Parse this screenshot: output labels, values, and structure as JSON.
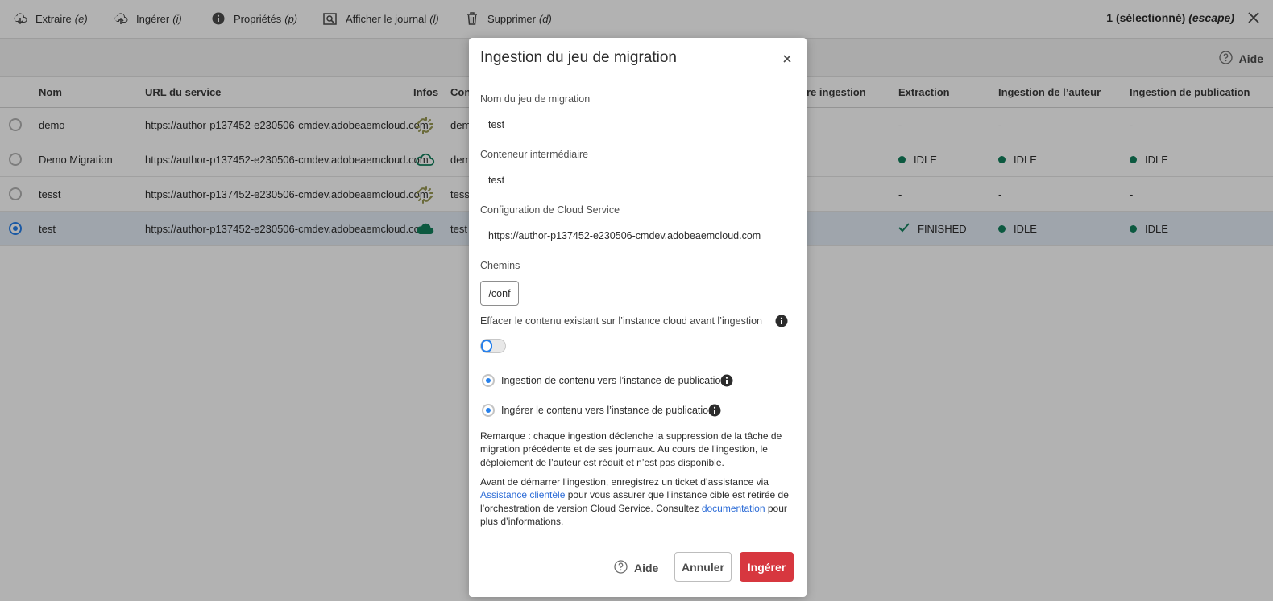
{
  "toolbar": {
    "actions": [
      {
        "label": "Extraire",
        "key": "(e)",
        "icon": "cloud-download-icon"
      },
      {
        "label": "Ingérer",
        "key": "(i)",
        "icon": "cloud-upload-icon"
      },
      {
        "label": "Propriétés",
        "key": "(p)",
        "icon": "info-icon"
      },
      {
        "label": "Afficher le journal",
        "key": "(l)",
        "icon": "view-log-icon"
      },
      {
        "label": "Supprimer",
        "key": "(d)",
        "icon": "trash-icon"
      }
    ],
    "selection": "1 (sélectionné)",
    "selection_key": "(escape)"
  },
  "subheader": {
    "help_label": "Aide"
  },
  "table": {
    "headers": {
      "name": "Nom",
      "url": "URL du service",
      "info": "Infos",
      "container": "Cont",
      "last_ingest": "re ingestion",
      "extraction": "Extraction",
      "author": "Ingestion de l’auteur",
      "publish": "Ingestion de publication"
    },
    "rows": [
      {
        "name": "demo",
        "url": "https://author-p137452-e230506-cmdev.adobeaemcloud.com",
        "container": "dem",
        "extraction": "-",
        "author": "-",
        "publish": "-",
        "info_icon": "broken-link-icon",
        "selected": false
      },
      {
        "name": "Demo Migration",
        "url": "https://author-p137452-e230506-cmdev.adobeaemcloud.com",
        "container": "dem",
        "extraction": "IDLE",
        "author": "IDLE",
        "publish": "IDLE",
        "info_icon": "cloud-outline-icon",
        "selected": false
      },
      {
        "name": "tesst",
        "url": "https://author-p137452-e230506-cmdev.adobeaemcloud.com",
        "container": "tesst",
        "extraction": "-",
        "author": "-",
        "publish": "-",
        "info_icon": "broken-link-icon",
        "selected": false
      },
      {
        "name": "test",
        "url": "https://author-p137452-e230506-cmdev.adobeaemcloud.com",
        "container": "test",
        "extraction": "FINISHED",
        "author": "IDLE",
        "publish": "IDLE",
        "info_icon": "cloud-filled-icon",
        "selected": true
      }
    ]
  },
  "colors": {
    "accent": "#2680eb",
    "status_green": "#12805c",
    "danger": "#d7373f",
    "link": "#2b6bd6"
  },
  "modal": {
    "title": "Ingestion du jeu de migration",
    "name_label": "Nom du jeu de migration",
    "name_value": "test",
    "container_label": "Conteneur intermédiaire",
    "container_value": "test",
    "cloud_config_label": "Configuration de Cloud Service",
    "cloud_config_value": "https://author-p137452-e230506-cmdev.adobeaemcloud.com",
    "paths_label": "Chemins",
    "path_chip": "/conf",
    "wipe_label": "Effacer le contenu existant sur l’instance cloud avant l’ingestion",
    "wipe_enabled": false,
    "radio1_label": "Ingestion de contenu vers l’instance de publication",
    "radio2_label": "Ingérer le contenu vers l’instance de publication",
    "note": "Remarque : chaque ingestion déclenche la suppression de la tâche de migration précédente et de ses journaux. Au cours de l’ingestion, le déploiement de l’auteur est réduit et n’est pas disponible.",
    "support_before": "Avant de démarrer l’ingestion, enregistrez un ticket d’assistance via ",
    "support_link": "Assistance clientèle",
    "support_middle": " pour vous assurer que l’instance cible est retirée de l’orchestration de version Cloud Service. Consultez ",
    "doc_link": "documentation",
    "support_after": " pour plus d’informations.",
    "help_label": "Aide",
    "cancel_label": "Annuler",
    "ingest_label": "Ingérer"
  }
}
